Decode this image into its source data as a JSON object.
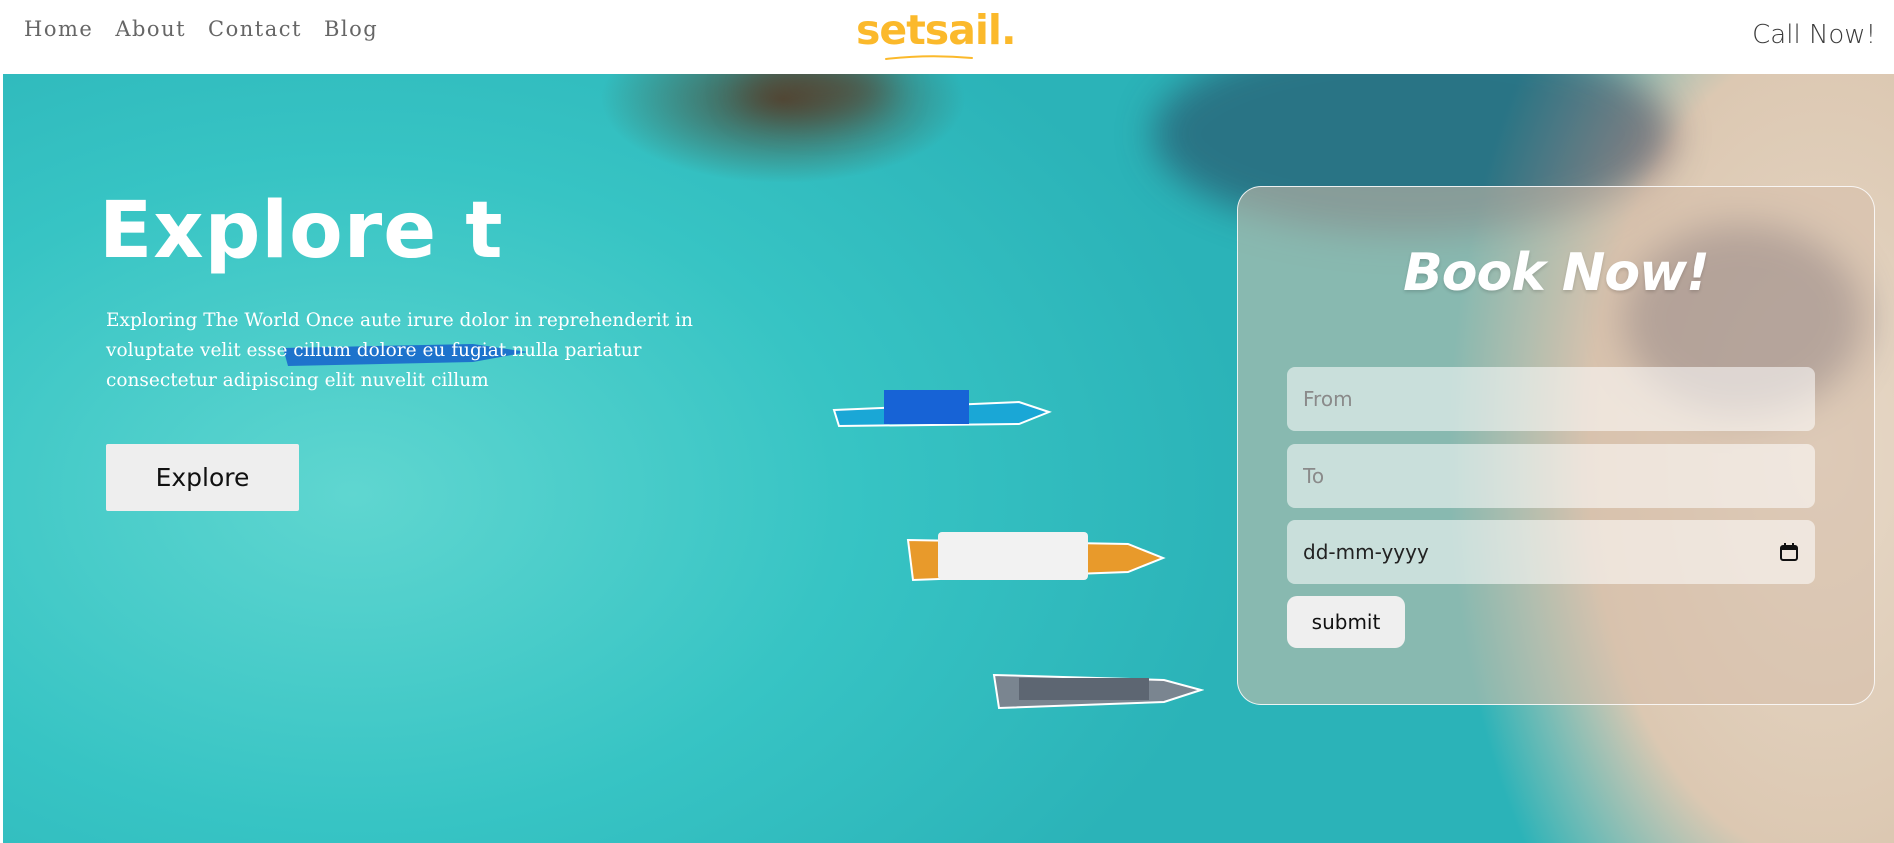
{
  "nav": {
    "links": [
      "Home",
      "About",
      "Contact",
      "Blog"
    ],
    "logo_text": "setsail.",
    "call_now": "Call Now!"
  },
  "hero": {
    "title": "Explore t",
    "description": "Exploring The World Once aute irure dolor in reprehenderit in voluptate velit esse cillum dolore eu fugiat nulla pariatur consectetur adipiscing elit nuvelit cillum",
    "explore_button": "Explore"
  },
  "booking": {
    "title": "Book Now!",
    "from_placeholder": "From",
    "to_placeholder": "To",
    "date_placeholder": "dd-mm-yyyy",
    "submit_label": "submit"
  },
  "colors": {
    "brand": "#fbb92b",
    "water": "#3cc9c8",
    "sand": "#e3d2bf"
  }
}
